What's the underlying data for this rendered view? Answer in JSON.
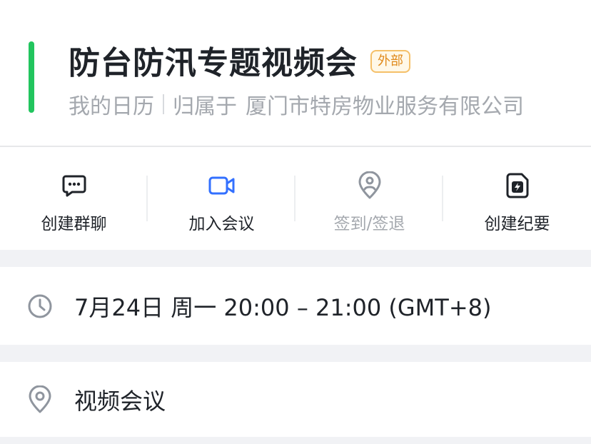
{
  "event": {
    "title": "防台防汛专题视频会",
    "badge": "外部",
    "calendar": "我的日历",
    "owner_prefix": "归属于",
    "owner_name": "厦门市特房物业服务有限公司",
    "accent_color": "#22c55e"
  },
  "actions": [
    {
      "label": "创建群聊",
      "icon": "chat-icon",
      "enabled": true
    },
    {
      "label": "加入会议",
      "icon": "video-camera-icon",
      "enabled": true,
      "color": "#3370ff"
    },
    {
      "label": "签到/签退",
      "icon": "location-checkin-icon",
      "enabled": false
    },
    {
      "label": "创建纪要",
      "icon": "notes-icon",
      "enabled": true
    }
  ],
  "details": {
    "time": {
      "icon": "clock-icon",
      "text": "7月24日 周一 20:00 – 21:00 (GMT+8)"
    },
    "location": {
      "icon": "location-pin-icon",
      "text": "视频会议"
    }
  }
}
